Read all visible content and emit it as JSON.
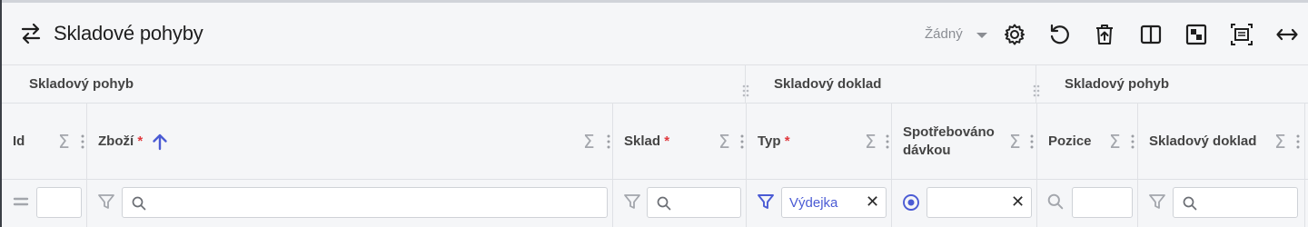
{
  "header": {
    "title": "Skladové pohyby",
    "preset_label": "Žádný",
    "toolbar_icons": [
      "gear-icon",
      "reset-icon",
      "delete-icon",
      "split-view-icon",
      "toggle-panel-icon",
      "fit-icon",
      "expand-width-icon"
    ]
  },
  "groups": [
    {
      "label": "Skladový pohyb"
    },
    {
      "label": "Skladový doklad"
    },
    {
      "label": "Skladový pohyb"
    }
  ],
  "columns": [
    {
      "label": "Id",
      "required": false
    },
    {
      "label": "Zboží",
      "required": true,
      "sort": "ascending"
    },
    {
      "label": "Sklad",
      "required": true
    },
    {
      "label": "Typ",
      "required": true
    },
    {
      "label_line1": "Spotřebováno",
      "label_line2": "dávkou",
      "required": false
    },
    {
      "label": "Pozice",
      "required": false
    },
    {
      "label": "Skladový doklad",
      "required": false
    }
  ],
  "required_mark": "*",
  "filters": {
    "typ_value": "Výdejka",
    "clear_symbol": "✕"
  },
  "colors": {
    "accent": "#4b5bd4",
    "required": "#e0393e",
    "muted_icon": "#a3a6ac",
    "header_bg": "#f5f6f8"
  }
}
